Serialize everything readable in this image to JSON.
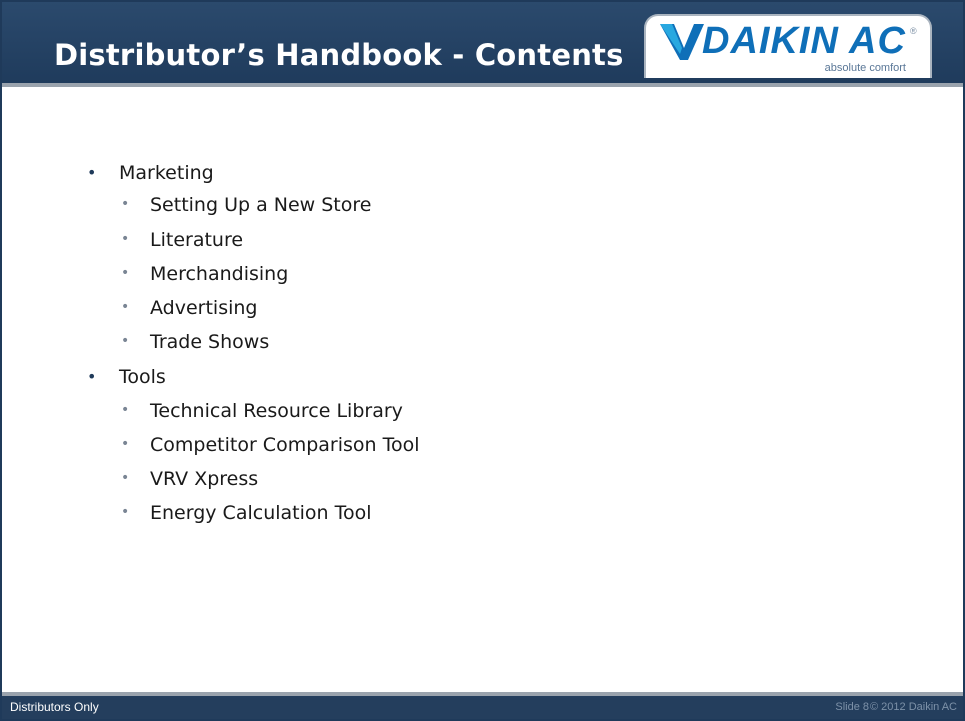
{
  "slide": {
    "title": "Distributor’s Handbook - Contents",
    "logo": {
      "brand": "DAIKIN AC",
      "registered": "®",
      "tagline": "absolute comfort",
      "brand_color": "#0f6fb8"
    },
    "outline": [
      {
        "label": "Marketing",
        "level": 1
      },
      {
        "label": "Setting Up a New Store",
        "level": 2
      },
      {
        "label": "Literature",
        "level": 2
      },
      {
        "label": "Merchandising",
        "level": 2
      },
      {
        "label": "Advertising",
        "level": 2
      },
      {
        "label": "Trade Shows",
        "level": 2
      },
      {
        "label": "Tools",
        "level": 1
      },
      {
        "label": "Technical Resource Library",
        "level": 2
      },
      {
        "label": "Competitor Comparison Tool",
        "level": 2
      },
      {
        "label": "VRV Xpress",
        "level": 2
      },
      {
        "label": "Energy Calculation Tool",
        "level": 2
      }
    ],
    "bullet_char": "•",
    "footer": {
      "left": "Distributors Only",
      "slide_number": "Slide 8",
      "copyright": "© 2012 Daikin AC"
    }
  },
  "colors": {
    "header_bg": "#1f3b5c",
    "footer_bg": "#243e5d",
    "bullet_l1": "#1f3a5a",
    "bullet_l2": "#7a8594"
  }
}
